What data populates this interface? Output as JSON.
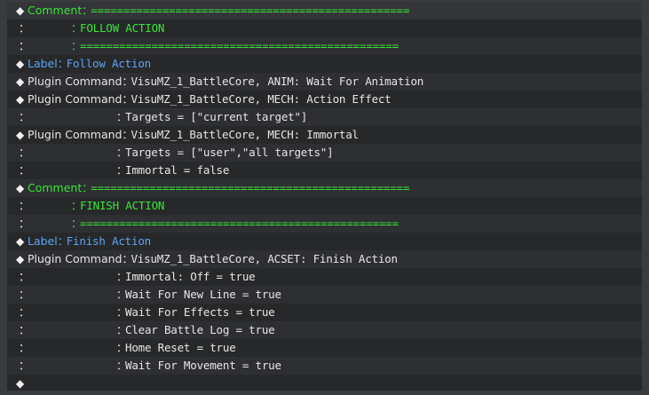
{
  "rows": [
    {
      "lead": "◆",
      "cmd": "Comment",
      "cmd_color": "green",
      "pad": "",
      "sep": "：",
      "body": "=================================================",
      "body_color": "green"
    },
    {
      "lead": "",
      "cmd": "",
      "cmd_color": "white",
      "pad": "",
      "sep": "：",
      "body": "FOLLOW ACTION",
      "body_color": "green",
      "cont_indent": "comment"
    },
    {
      "lead": "",
      "cmd": "",
      "cmd_color": "white",
      "pad": "",
      "sep": "：",
      "body": "=================================================",
      "body_color": "green",
      "cont_indent": "comment"
    },
    {
      "lead": "◆",
      "cmd": "Label",
      "cmd_color": "blue",
      "pad": "",
      "sep": "：",
      "body": "Follow Action",
      "body_color": "blue"
    },
    {
      "lead": "◆",
      "cmd": "Plugin Command",
      "cmd_color": "white",
      "pad": "",
      "sep": "：",
      "body": "VisuMZ_1_BattleCore, ANIM: Wait For Animation",
      "body_color": "white"
    },
    {
      "lead": "◆",
      "cmd": "Plugin Command",
      "cmd_color": "white",
      "pad": "",
      "sep": "：",
      "body": "VisuMZ_1_BattleCore, MECH: Action Effect",
      "body_color": "white"
    },
    {
      "lead": "",
      "cmd": "",
      "cmd_color": "white",
      "pad": "",
      "sep": "：",
      "body": "Targets = [\"current target\"]",
      "body_color": "white",
      "cont_indent": "plugin"
    },
    {
      "lead": "◆",
      "cmd": "Plugin Command",
      "cmd_color": "white",
      "pad": "",
      "sep": "：",
      "body": "VisuMZ_1_BattleCore, MECH: Immortal",
      "body_color": "white"
    },
    {
      "lead": "",
      "cmd": "",
      "cmd_color": "white",
      "pad": "",
      "sep": "：",
      "body": "Targets = [\"user\",\"all targets\"]",
      "body_color": "white",
      "cont_indent": "plugin"
    },
    {
      "lead": "",
      "cmd": "",
      "cmd_color": "white",
      "pad": "",
      "sep": "：",
      "body": "Immortal = false",
      "body_color": "white",
      "cont_indent": "plugin"
    },
    {
      "lead": "◆",
      "cmd": "Comment",
      "cmd_color": "green",
      "pad": "",
      "sep": "：",
      "body": "=================================================",
      "body_color": "green"
    },
    {
      "lead": "",
      "cmd": "",
      "cmd_color": "white",
      "pad": "",
      "sep": "：",
      "body": "FINISH ACTION",
      "body_color": "green",
      "cont_indent": "comment"
    },
    {
      "lead": "",
      "cmd": "",
      "cmd_color": "white",
      "pad": "",
      "sep": "：",
      "body": "=================================================",
      "body_color": "green",
      "cont_indent": "comment"
    },
    {
      "lead": "◆",
      "cmd": "Label",
      "cmd_color": "blue",
      "pad": "",
      "sep": "：",
      "body": "Finish Action",
      "body_color": "blue"
    },
    {
      "lead": "◆",
      "cmd": "Plugin Command",
      "cmd_color": "white",
      "pad": "",
      "sep": "：",
      "body": "VisuMZ_1_BattleCore, ACSET: Finish Action",
      "body_color": "white"
    },
    {
      "lead": "",
      "cmd": "",
      "cmd_color": "white",
      "pad": "",
      "sep": "：",
      "body": "Immortal: Off = true",
      "body_color": "white",
      "cont_indent": "plugin"
    },
    {
      "lead": "",
      "cmd": "",
      "cmd_color": "white",
      "pad": "",
      "sep": "：",
      "body": "Wait For New Line = true",
      "body_color": "white",
      "cont_indent": "plugin"
    },
    {
      "lead": "",
      "cmd": "",
      "cmd_color": "white",
      "pad": "",
      "sep": "：",
      "body": "Wait For Effects = true",
      "body_color": "white",
      "cont_indent": "plugin"
    },
    {
      "lead": "",
      "cmd": "",
      "cmd_color": "white",
      "pad": "",
      "sep": "：",
      "body": "Clear Battle Log = true",
      "body_color": "white",
      "cont_indent": "plugin"
    },
    {
      "lead": "",
      "cmd": "",
      "cmd_color": "white",
      "pad": "",
      "sep": "：",
      "body": "Home Reset = true",
      "body_color": "white",
      "cont_indent": "plugin"
    },
    {
      "lead": "",
      "cmd": "",
      "cmd_color": "white",
      "pad": "",
      "sep": "：",
      "body": "Wait For Movement = true",
      "body_color": "white",
      "cont_indent": "plugin"
    },
    {
      "lead": "◆",
      "cmd": "",
      "cmd_color": "white",
      "pad": "",
      "sep": "",
      "body": "",
      "body_color": "white"
    }
  ],
  "colors": {
    "green": "#39e639",
    "blue": "#5fa3f2",
    "white": "#e6e6e6",
    "background": "#28292b"
  },
  "icons": {
    "lead": "diamond-icon"
  }
}
